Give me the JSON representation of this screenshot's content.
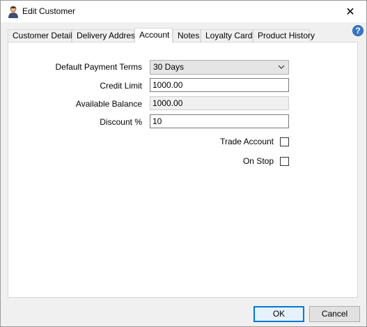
{
  "window": {
    "title": "Edit Customer",
    "close_glyph": "✕",
    "help_glyph": "?"
  },
  "tabs": [
    {
      "label": "Customer Details",
      "active": false
    },
    {
      "label": "Delivery Address",
      "active": false
    },
    {
      "label": "Account",
      "active": true
    },
    {
      "label": "Notes",
      "active": false
    },
    {
      "label": "Loyalty Cards",
      "active": false
    },
    {
      "label": "Product History",
      "active": false
    }
  ],
  "account": {
    "payment_terms_label": "Default Payment Terms",
    "payment_terms_value": "30 Days",
    "credit_limit_label": "Credit Limit",
    "credit_limit_value": "1000.00",
    "available_balance_label": "Available Balance",
    "available_balance_value": "1000.00",
    "discount_label": "Discount %",
    "discount_value": "10",
    "trade_account_label": "Trade Account",
    "trade_account_checked": false,
    "on_stop_label": "On Stop",
    "on_stop_checked": false
  },
  "buttons": {
    "ok": "OK",
    "cancel": "Cancel"
  },
  "colors": {
    "accent": "#0078d7",
    "help_icon": "#3a77c6"
  }
}
